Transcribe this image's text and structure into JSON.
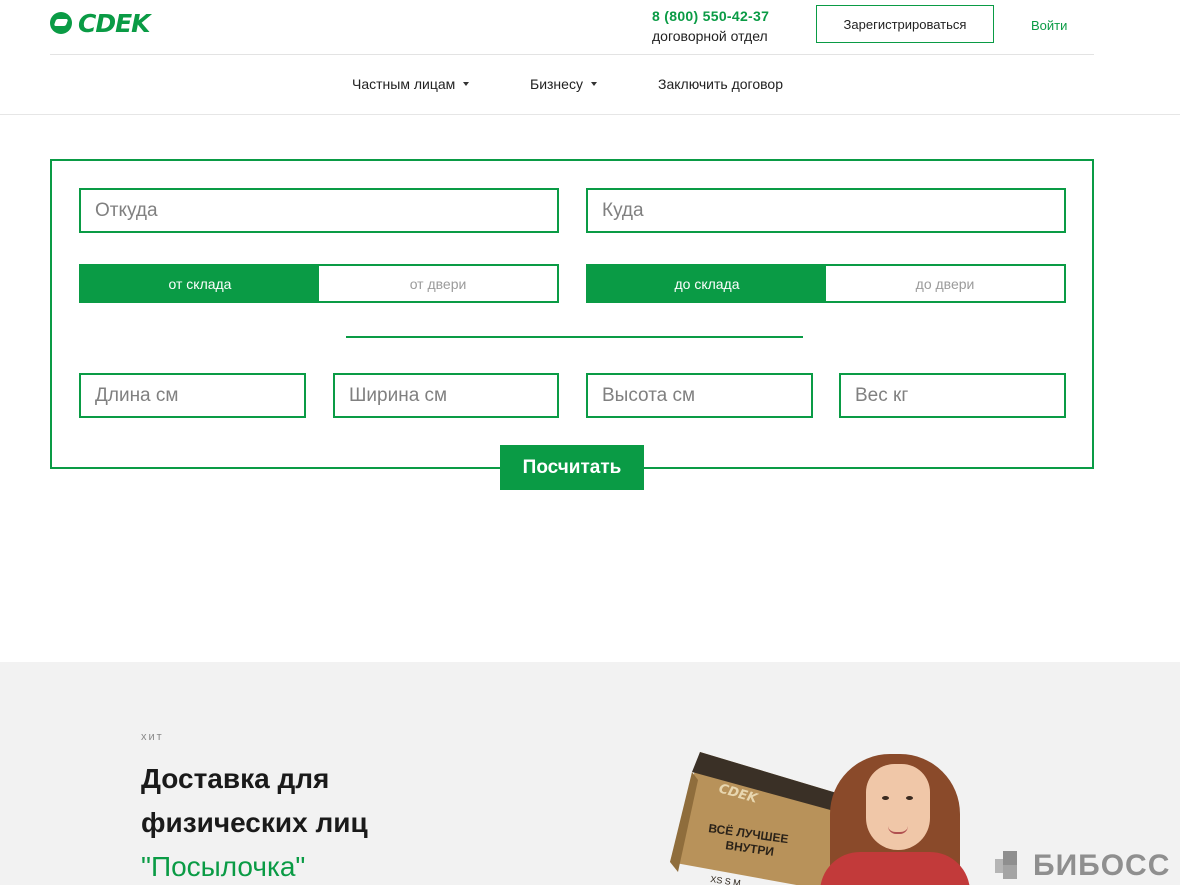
{
  "brand": {
    "logo_text": "CDEK",
    "color": "#0a9b45"
  },
  "header": {
    "phone": "8 (800) 550-42-37",
    "phone_caption": "договорной отдел",
    "register_label": "Зарегистрироваться",
    "login_label": "Войти"
  },
  "nav": {
    "items": [
      {
        "label": "Частным лицам",
        "has_dropdown": true
      },
      {
        "label": "Бизнесу",
        "has_dropdown": true
      },
      {
        "label": "Заключить договор",
        "has_dropdown": false
      }
    ]
  },
  "calculator": {
    "from_placeholder": "Откуда",
    "to_placeholder": "Куда",
    "from_toggle": {
      "active": "от склада",
      "inactive": "от двери"
    },
    "to_toggle": {
      "active": "до склада",
      "inactive": "до двери"
    },
    "length_placeholder": "Длина см",
    "width_placeholder": "Ширина см",
    "height_placeholder": "Высота см",
    "weight_placeholder": "Вес кг",
    "submit_label": "Посчитать"
  },
  "promo": {
    "tag": "хит",
    "title_line1": "Доставка для",
    "title_line2": "физических лиц",
    "title_accent": "\"Посылочка\"",
    "box_logo": "CDEK",
    "box_text_line1": "ВСЁ ЛУЧШЕЕ",
    "box_text_line2": "ВНУТРИ",
    "box_sizes": "XS S M"
  },
  "watermark": {
    "text": "БИБОСС"
  }
}
